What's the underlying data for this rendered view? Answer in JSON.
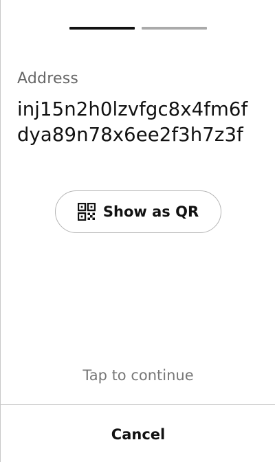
{
  "progress": {
    "total_steps": 2,
    "current_step": 1
  },
  "address": {
    "label": "Address",
    "value": "inj15n2h0lzvfgc8x4fm6fdya89n78x6ee2f3h7z3f"
  },
  "qr_button": {
    "label": "Show as QR",
    "icon": "qr-code-icon"
  },
  "hint": {
    "text": "Tap to continue"
  },
  "footer": {
    "cancel_label": "Cancel"
  },
  "colors": {
    "text": "#111111",
    "muted": "#666666",
    "progress_active": "#111111",
    "progress_inactive": "#aaaaaa",
    "border": "#b4b4b4"
  }
}
